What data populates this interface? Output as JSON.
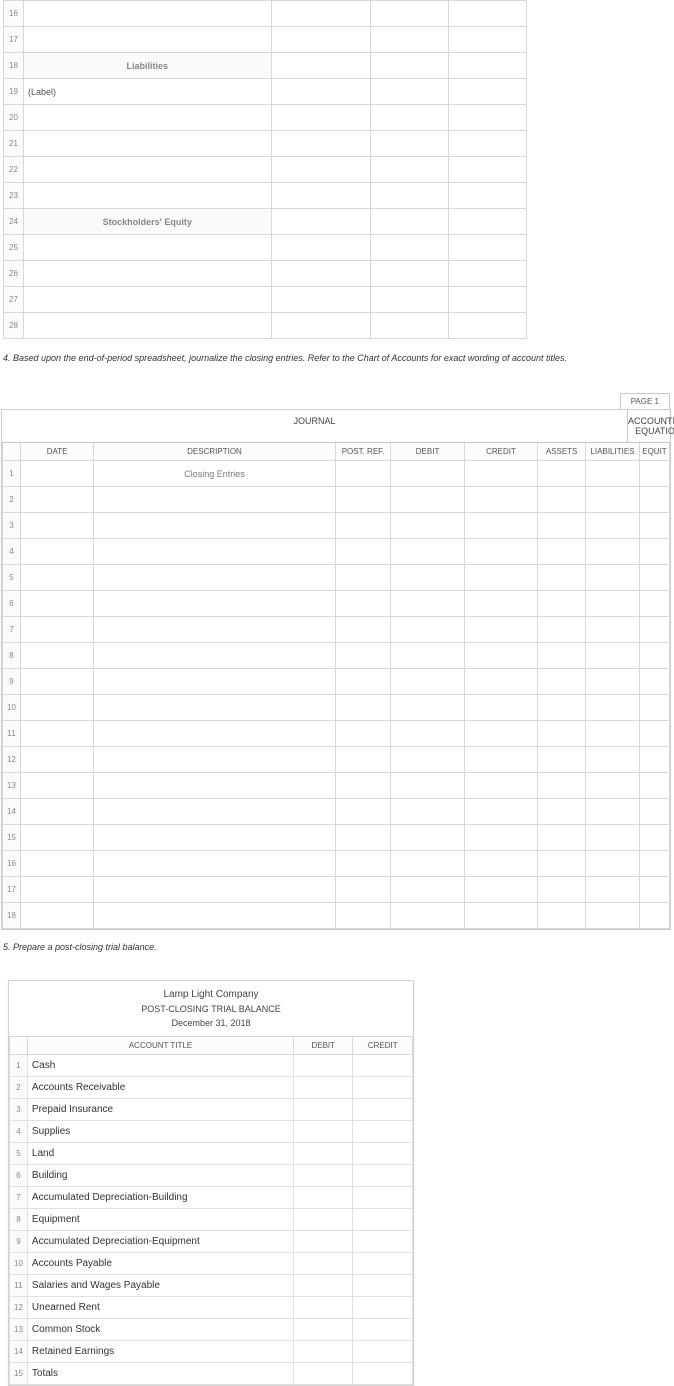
{
  "spreadsheet_top": {
    "rows": [
      {
        "num": "16",
        "desc": ""
      },
      {
        "num": "17",
        "desc": ""
      },
      {
        "num": "18",
        "desc": "Liabilities",
        "header": true
      },
      {
        "num": "19",
        "desc": "(Label)"
      },
      {
        "num": "20",
        "desc": ""
      },
      {
        "num": "21",
        "desc": ""
      },
      {
        "num": "22",
        "desc": ""
      },
      {
        "num": "23",
        "desc": ""
      },
      {
        "num": "24",
        "desc": "Stockholders' Equity",
        "header": true
      },
      {
        "num": "25",
        "desc": ""
      },
      {
        "num": "26",
        "desc": ""
      },
      {
        "num": "27",
        "desc": ""
      },
      {
        "num": "28",
        "desc": ""
      }
    ]
  },
  "question4": "4. Based upon the end-of-period spreadsheet, journalize the closing entries. Refer to the Chart of Accounts for exact wording of account titles.",
  "journal": {
    "page_tab": "PAGE 1",
    "header_left": "JOURNAL",
    "header_right": "ACCOUNTING EQUATION",
    "columns": {
      "date": "DATE",
      "desc": "DESCRIPTION",
      "ref": "POST. REF.",
      "debit": "DEBIT",
      "credit": "CREDIT",
      "assets": "ASSETS",
      "liab": "LIABILITIES",
      "equity": "EQUIT"
    },
    "first_row_desc": "Closing Entries",
    "row_count": 18
  },
  "question5": "5. Prepare a post-closing trial balance.",
  "trial_balance": {
    "company": "Lamp Light Company",
    "title": "POST-CLOSING TRIAL BALANCE",
    "date": "December 31, 2018",
    "columns": {
      "acct": "ACCOUNT TITLE",
      "debit": "DEBIT",
      "credit": "CREDIT"
    },
    "rows": [
      "Cash",
      "Accounts Receivable",
      "Prepaid Insurance",
      "Supplies",
      "Land",
      "Building",
      "Accumulated Depreciation-Building",
      "Equipment",
      "Accumulated Depreciation-Equipment",
      "Accounts Payable",
      "Salaries and Wages Payable",
      "Unearned Rent",
      "Common Stock",
      "Retained Earnings",
      "Totals"
    ]
  }
}
